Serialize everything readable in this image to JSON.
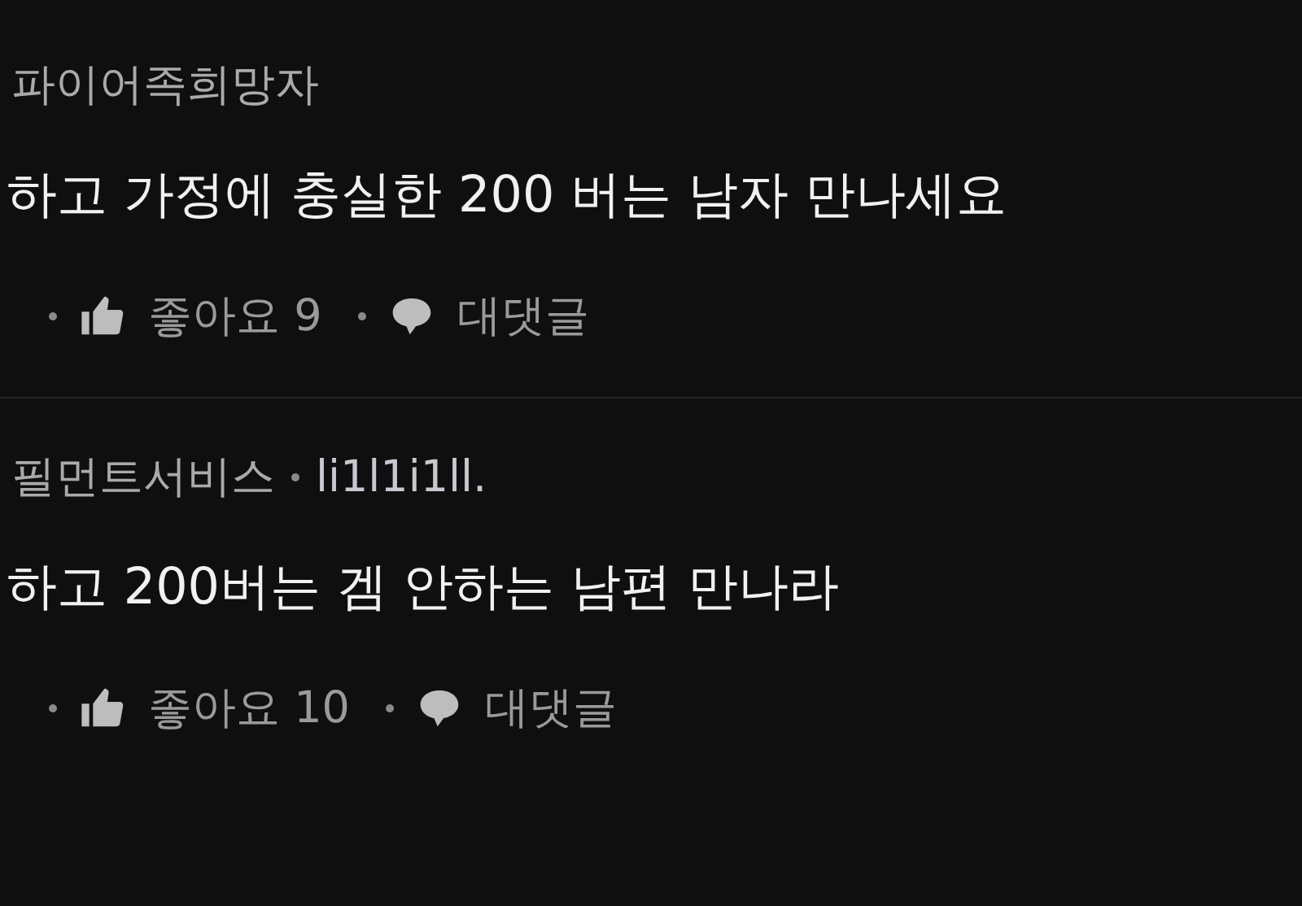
{
  "comments": [
    {
      "meta": [
        "파이어족희망자"
      ],
      "body": "하고 가정에 충실한 200 버는 남자 만나세요",
      "likes": "좋아요 9",
      "reply": "대댓글"
    },
    {
      "meta": [
        "필먼트서비스",
        "li1l1i1ll."
      ],
      "body": "하고 200버는 겜 안하는 남편 만나라",
      "likes": "좋아요 10",
      "reply": "대댓글"
    }
  ]
}
